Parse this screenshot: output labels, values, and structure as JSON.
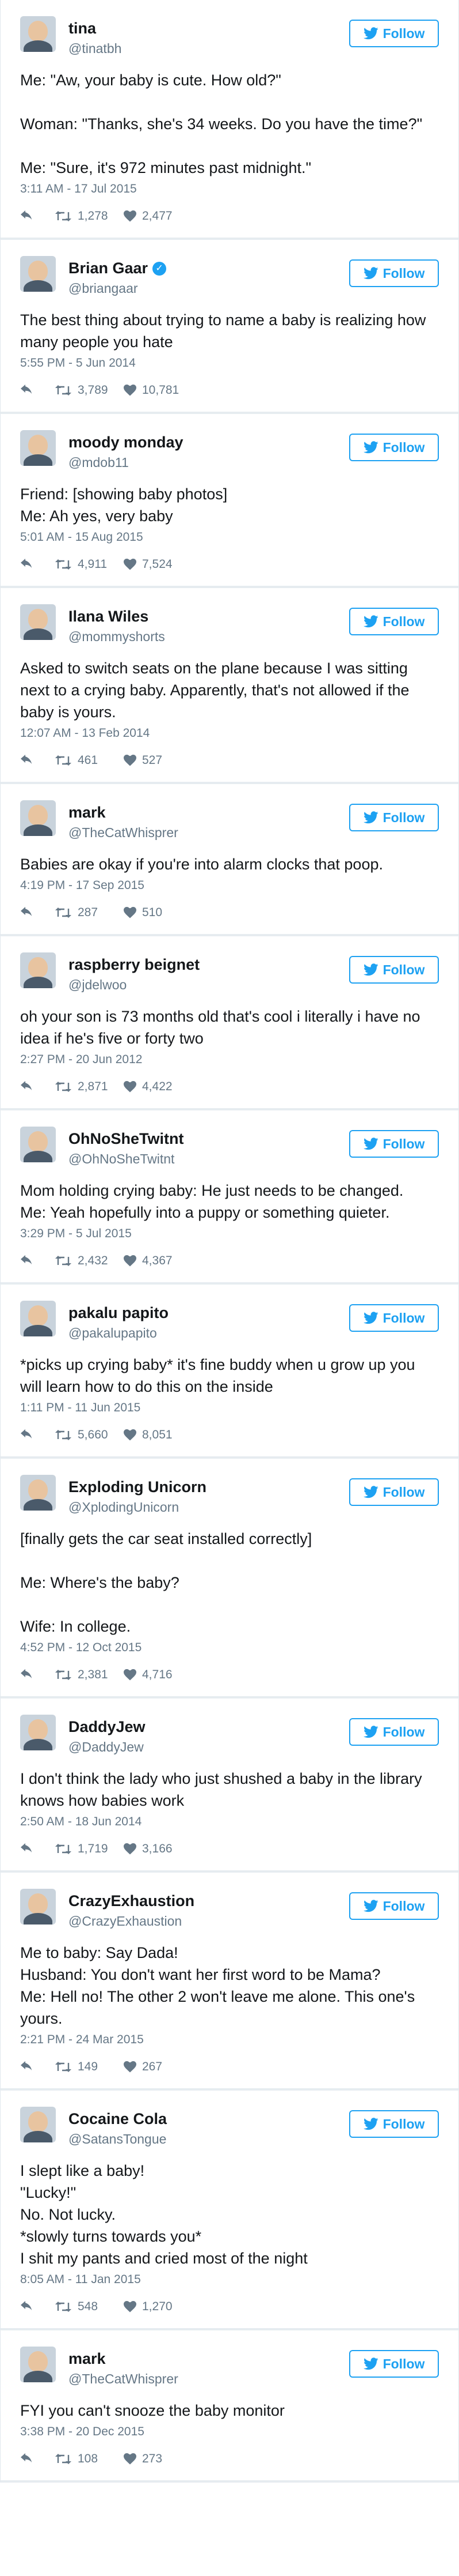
{
  "follow_label": "Follow",
  "colors": {
    "accent": "#1da1f2",
    "muted": "#657786",
    "separator": "#e6ecf0"
  },
  "icons": {
    "bird": "twitter-bird-icon",
    "reply": "reply-icon",
    "retweet": "retweet-icon",
    "like": "heart-icon",
    "verified": "verified-badge-icon"
  },
  "tweets": [
    {
      "name": "tina",
      "handle": "@tinatbh",
      "verified": false,
      "lines": [
        "Me: \"Aw, your baby is cute. How old?\"",
        "",
        "Woman: \"Thanks, she's 34 weeks. Do you have the time?\"",
        "",
        "Me: \"Sure, it's 972 minutes past midnight.\""
      ],
      "timestamp": "3:11 AM - 17 Jul 2015",
      "retweets": "1,278",
      "likes": "2,477"
    },
    {
      "name": "Brian Gaar",
      "handle": "@briangaar",
      "verified": true,
      "lines": [
        "The best thing about trying to name a baby is realizing how many people you hate"
      ],
      "timestamp": "5:55 PM - 5 Jun 2014",
      "retweets": "3,789",
      "likes": "10,781"
    },
    {
      "name": "moody monday",
      "handle": "@mdob11",
      "verified": false,
      "lines": [
        "Friend: [showing baby photos]",
        "Me: Ah yes, very baby"
      ],
      "timestamp": "5:01 AM - 15 Aug 2015",
      "retweets": "4,911",
      "likes": "7,524"
    },
    {
      "name": "Ilana Wiles",
      "handle": "@mommyshorts",
      "verified": false,
      "lines": [
        "Asked to switch seats on the plane because I was sitting next to a crying baby. Apparently, that's not allowed if the baby is yours."
      ],
      "timestamp": "12:07 AM - 13 Feb 2014",
      "retweets": "461",
      "likes": "527"
    },
    {
      "name": "mark",
      "handle": "@TheCatWhisprer",
      "verified": false,
      "lines": [
        "Babies are okay if you're into alarm clocks that poop."
      ],
      "timestamp": "4:19 PM - 17 Sep 2015",
      "retweets": "287",
      "likes": "510"
    },
    {
      "name": "raspberry beignet",
      "handle": "@jdelwoo",
      "verified": false,
      "lines": [
        "oh your son is 73 months old that's cool i literally i have no idea if he's five or forty two"
      ],
      "timestamp": "2:27 PM - 20 Jun 2012",
      "retweets": "2,871",
      "likes": "4,422"
    },
    {
      "name": "OhNoSheTwitnt",
      "handle": "@OhNoSheTwitnt",
      "verified": false,
      "lines": [
        "Mom holding crying baby: He just needs to be changed.",
        "Me: Yeah hopefully into a puppy or something quieter."
      ],
      "timestamp": "3:29 PM - 5 Jul 2015",
      "retweets": "2,432",
      "likes": "4,367"
    },
    {
      "name": "pakalu papito",
      "handle": "@pakalupapito",
      "verified": false,
      "lines": [
        "*picks up crying baby* it's fine buddy when u grow up you will learn how to do this on the inside"
      ],
      "timestamp": "1:11 PM - 11 Jun 2015",
      "retweets": "5,660",
      "likes": "8,051"
    },
    {
      "name": "Exploding Unicorn",
      "handle": "@XplodingUnicorn",
      "verified": false,
      "lines": [
        "[finally gets the car seat installed correctly]",
        "",
        "Me: Where's the baby?",
        "",
        "Wife: In college."
      ],
      "timestamp": "4:52 PM - 12 Oct 2015",
      "retweets": "2,381",
      "likes": "4,716"
    },
    {
      "name": "DaddyJew",
      "handle": "@DaddyJew",
      "verified": false,
      "lines": [
        "I don't think the lady who just shushed a baby in the library knows how babies work"
      ],
      "timestamp": "2:50 AM - 18 Jun 2014",
      "retweets": "1,719",
      "likes": "3,166"
    },
    {
      "name": "CrazyExhaustion",
      "handle": "@CrazyExhaustion",
      "verified": false,
      "lines": [
        "Me to baby: Say Dada!",
        "Husband: You don't want her first word to be Mama?",
        "Me: Hell no! The other 2 won't leave me alone. This one's yours."
      ],
      "timestamp": "2:21 PM - 24 Mar 2015",
      "retweets": "149",
      "likes": "267"
    },
    {
      "name": "Cocaine Cola",
      "handle": "@SatansTongue",
      "verified": false,
      "lines": [
        "I slept like a baby!",
        "\"Lucky!\"",
        "No. Not lucky.",
        "*slowly turns towards you*",
        "I shit my pants and cried most of the night"
      ],
      "timestamp": "8:05 AM - 11 Jan 2015",
      "retweets": "548",
      "likes": "1,270"
    },
    {
      "name": "mark",
      "handle": "@TheCatWhisprer",
      "verified": false,
      "lines": [
        "FYI you can't snooze the baby monitor"
      ],
      "timestamp": "3:38 PM - 20 Dec 2015",
      "retweets": "108",
      "likes": "273"
    }
  ]
}
